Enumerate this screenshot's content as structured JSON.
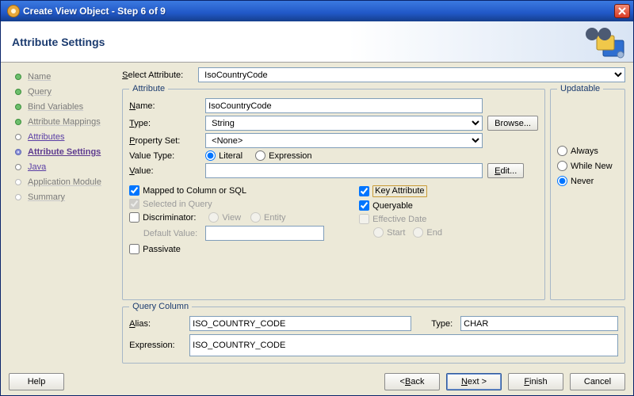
{
  "window": {
    "title": "Create View Object - Step 6 of 9"
  },
  "header": {
    "title": "Attribute Settings"
  },
  "steps": [
    {
      "label": "Name",
      "state": "done"
    },
    {
      "label": "Query",
      "state": "done"
    },
    {
      "label": "Bind Variables",
      "state": "done"
    },
    {
      "label": "Attribute Mappings",
      "state": "done"
    },
    {
      "label": "Attributes",
      "state": "link"
    },
    {
      "label": "Attribute Settings",
      "state": "current"
    },
    {
      "label": "Java",
      "state": "link"
    },
    {
      "label": "Application Module",
      "state": "future"
    },
    {
      "label": "Summary",
      "state": "future"
    }
  ],
  "labels": {
    "select_attribute": "Select Attribute:",
    "attribute_fs": "Attribute",
    "updatable_fs": "Updatable",
    "query_fs": "Query Column",
    "name": "Name:",
    "type": "Type:",
    "property_set": "Property Set:",
    "value_type": "Value Type:",
    "value": "Value:",
    "literal": "Literal",
    "expression": "Expression",
    "browse": "Browse...",
    "edit": "Edit...",
    "always": "Always",
    "while_new": "While New",
    "never": "Never",
    "mapped": "Mapped to Column or SQL",
    "sel_query": "Selected in Query",
    "discriminator": "Discriminator:",
    "view": "View",
    "entity": "Entity",
    "default_value": "Default Value:",
    "passivate": "Passivate",
    "key_attr": "Key Attribute",
    "queryable": "Queryable",
    "eff_date": "Effective Date",
    "start": "Start",
    "end": "End",
    "alias": "Alias:",
    "qtype": "Type:",
    "expr": "Expression:"
  },
  "values": {
    "select_attribute": "IsoCountryCode",
    "name": "IsoCountryCode",
    "type": "String",
    "property_set": "<None>",
    "value": "",
    "alias": "ISO_COUNTRY_CODE",
    "qtype": "CHAR",
    "qexpr": "ISO_COUNTRY_CODE"
  },
  "checks": {
    "literal": true,
    "expression": false,
    "mapped": true,
    "sel_query": true,
    "discriminator": false,
    "passivate": false,
    "key_attr": true,
    "queryable": true,
    "eff_date": false,
    "updatable": "never"
  },
  "footer": {
    "help": "Help",
    "back": "< Back",
    "next": "Next >",
    "finish": "Finish",
    "cancel": "Cancel"
  }
}
